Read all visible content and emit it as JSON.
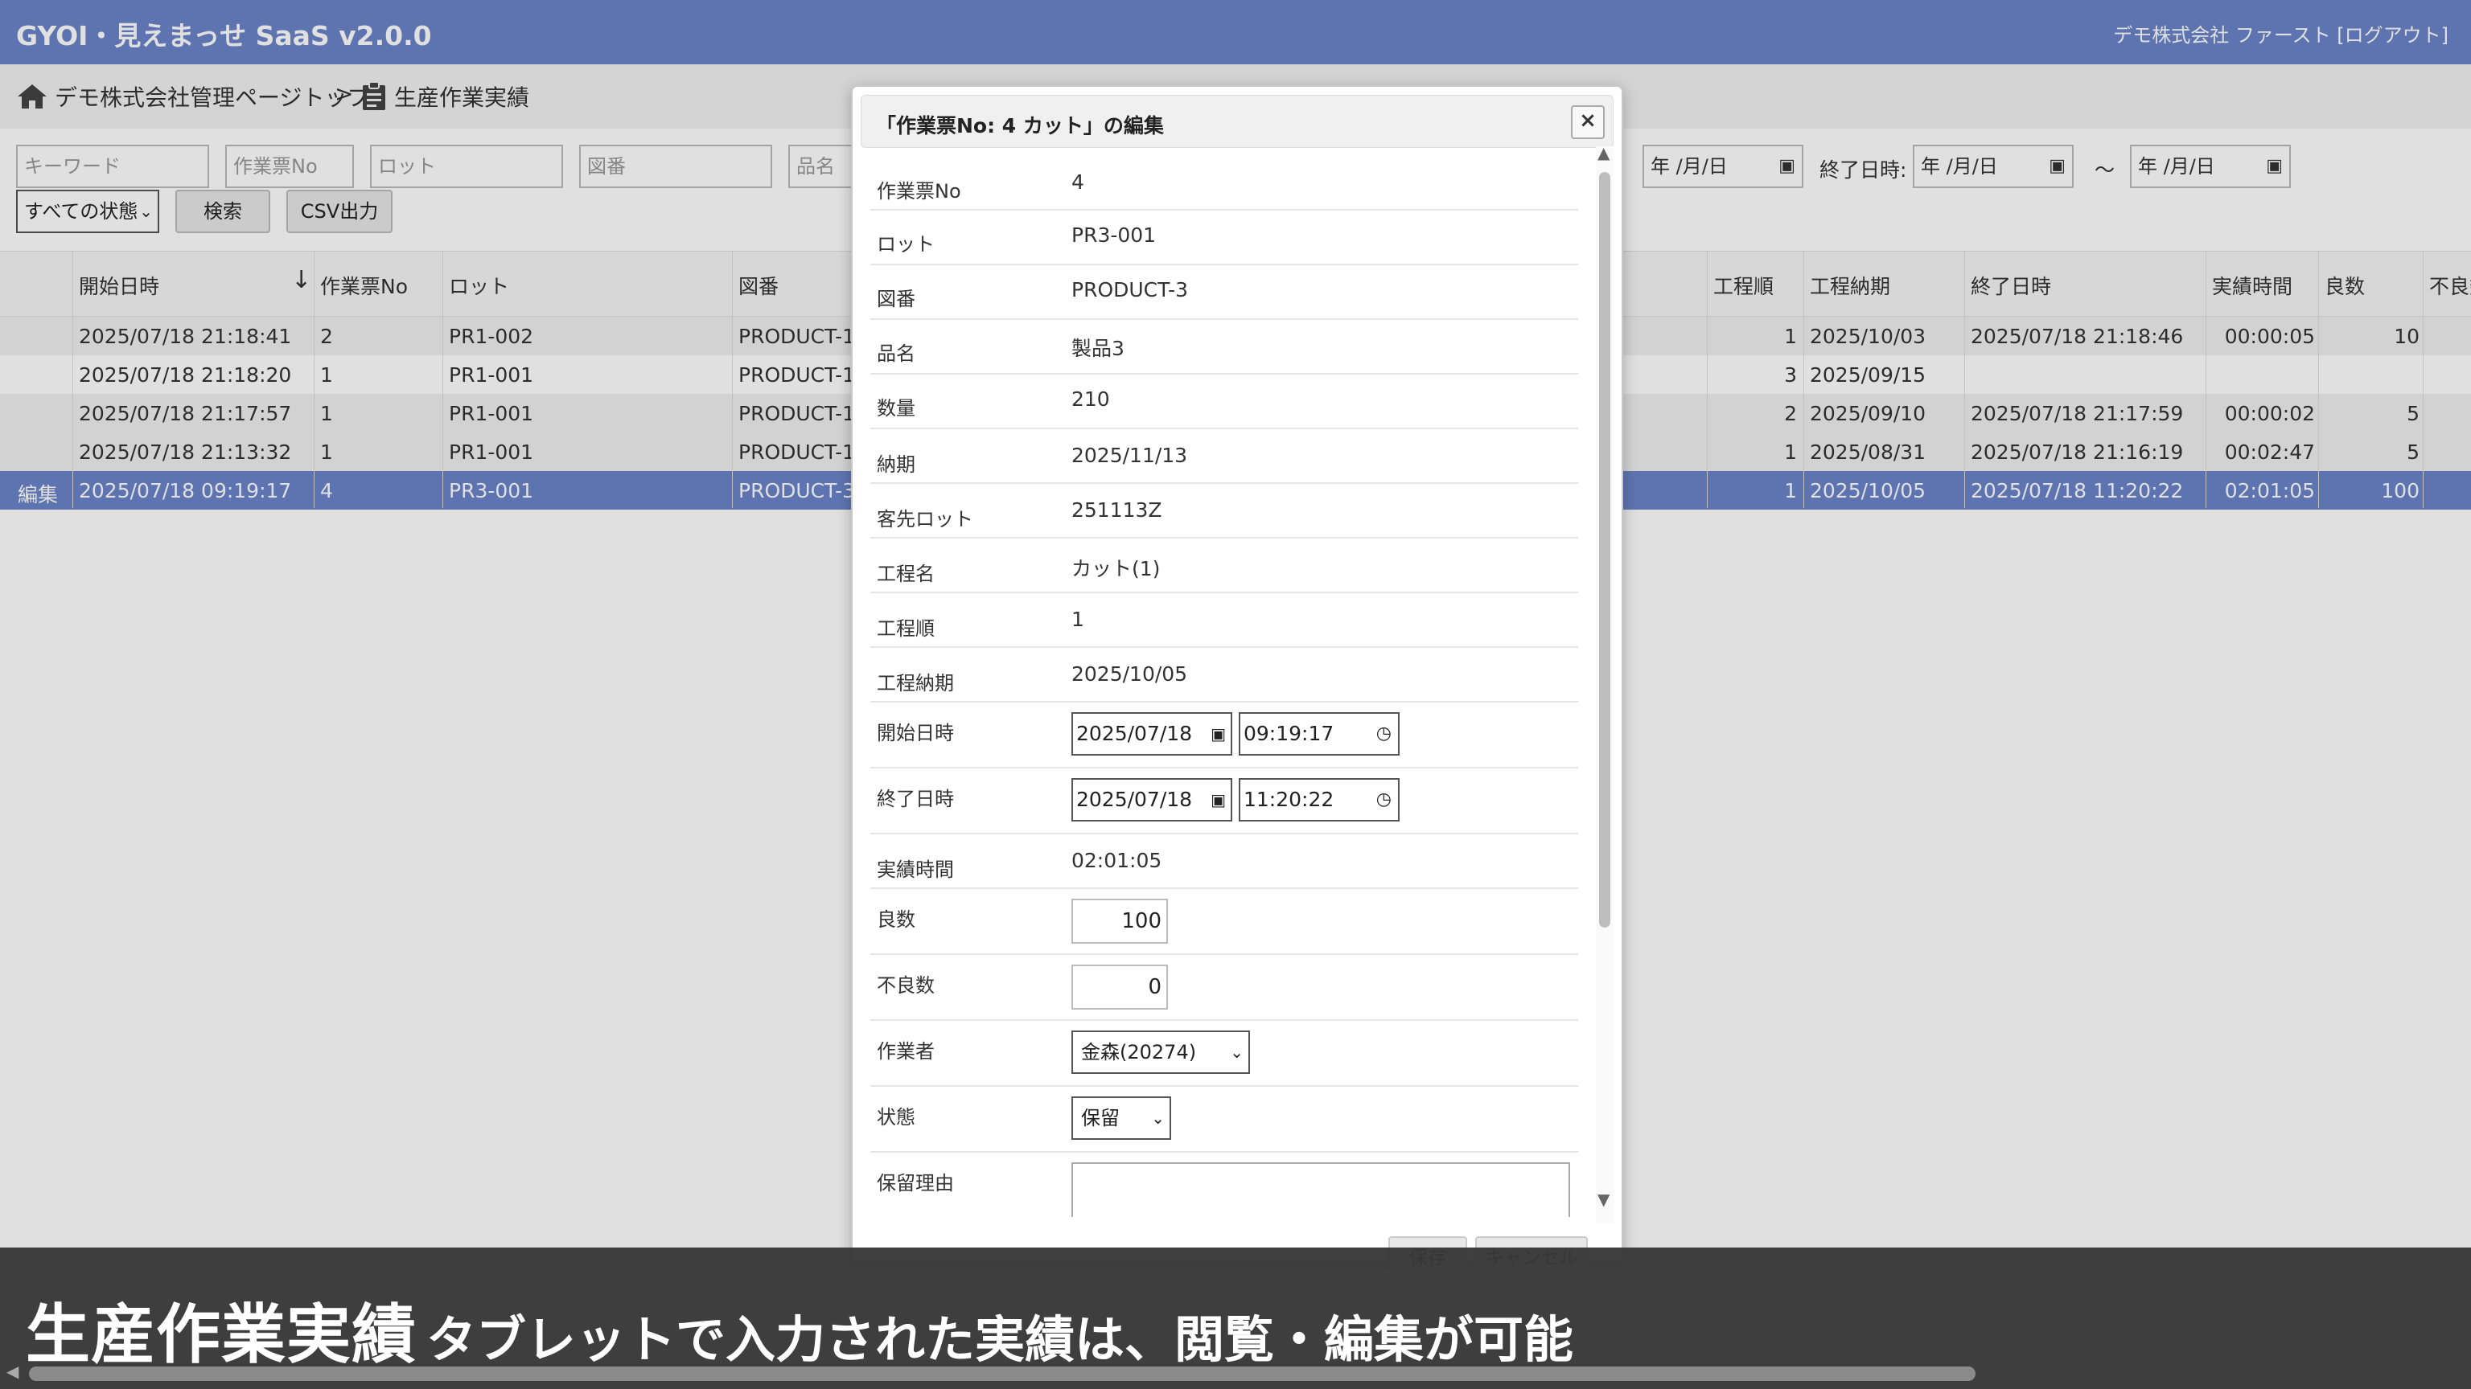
{
  "app": {
    "title": "GYOI・見えまっせ SaaS v2.0.0",
    "user_info": "デモ株式会社 ファースト [ログアウト]"
  },
  "breadcrumb": {
    "home": "デモ株式会社管理ページトップ",
    "separator": ">",
    "current": "生産作業実績"
  },
  "filters": {
    "keyword_placeholder": "キーワード",
    "slip_no_placeholder": "作業票No",
    "lot_placeholder": "ロット",
    "drawing_placeholder": "図番",
    "item_placeholder": "品名",
    "date_placeholder": "年 /月/日",
    "end_date_label": "終了日時:",
    "tilde": "～",
    "status_selected": "すべての状態",
    "search_button": "検索",
    "csv_button": "CSV出力"
  },
  "table": {
    "columns": {
      "start": "開始日時",
      "slip_no": "作業票No",
      "lot": "ロット",
      "drawing": "図番",
      "proc_order": "工程順",
      "proc_due": "工程納期",
      "end": "終了日時",
      "actual": "実績時間",
      "good": "良数",
      "defect": "不良数"
    },
    "rows": [
      {
        "edit": "",
        "start": "2025/07/18 21:18:41",
        "slip_no": "2",
        "lot": "PR1-002",
        "drawing": "PRODUCT-1",
        "proc_order": "1",
        "proc_due": "2025/10/03",
        "end": "2025/07/18 21:18:46",
        "actual": "00:00:05",
        "good": "10"
      },
      {
        "edit": "",
        "start": "2025/07/18 21:18:20",
        "slip_no": "1",
        "lot": "PR1-001",
        "drawing": "PRODUCT-1",
        "proc_order": "3",
        "proc_due": "2025/09/15",
        "end": "",
        "actual": "",
        "good": ""
      },
      {
        "edit": "",
        "start": "2025/07/18 21:17:57",
        "slip_no": "1",
        "lot": "PR1-001",
        "drawing": "PRODUCT-1",
        "proc_order": "2",
        "proc_due": "2025/09/10",
        "end": "2025/07/18 21:17:59",
        "actual": "00:00:02",
        "good": "5"
      },
      {
        "edit": "",
        "start": "2025/07/18 21:13:32",
        "slip_no": "1",
        "lot": "PR1-001",
        "drawing": "PRODUCT-1",
        "proc_order": "1",
        "proc_due": "2025/08/31",
        "end": "2025/07/18 21:16:19",
        "actual": "00:02:47",
        "good": "5"
      },
      {
        "edit": "編集",
        "start": "2025/07/18 09:19:17",
        "slip_no": "4",
        "lot": "PR3-001",
        "drawing": "PRODUCT-3",
        "proc_order": "1",
        "proc_due": "2025/10/05",
        "end": "2025/07/18 11:20:22",
        "actual": "02:01:05",
        "good": "100"
      }
    ]
  },
  "modal": {
    "title": "「作業票No: 4 カット」の編集",
    "fields": {
      "slip_no": {
        "label": "作業票No",
        "value": "4"
      },
      "lot": {
        "label": "ロット",
        "value": "PR3-001"
      },
      "drawing": {
        "label": "図番",
        "value": "PRODUCT-3"
      },
      "item": {
        "label": "品名",
        "value": "製品3"
      },
      "qty": {
        "label": "数量",
        "value": "210"
      },
      "due": {
        "label": "納期",
        "value": "2025/11/13"
      },
      "cust_lot": {
        "label": "客先ロット",
        "value": "251113Z"
      },
      "proc_name": {
        "label": "工程名",
        "value": "カット(1)"
      },
      "proc_order": {
        "label": "工程順",
        "value": "1"
      },
      "proc_due": {
        "label": "工程納期",
        "value": "2025/10/05"
      },
      "start": {
        "label": "開始日時",
        "date": "2025/07/18",
        "time": "09:19:17"
      },
      "end": {
        "label": "終了日時",
        "date": "2025/07/18",
        "time": "11:20:22"
      },
      "actual": {
        "label": "実績時間",
        "value": "02:01:05"
      },
      "good": {
        "label": "良数",
        "value": "100"
      },
      "defect": {
        "label": "不良数",
        "value": "0"
      },
      "worker": {
        "label": "作業者",
        "value": "金森(20274)"
      },
      "status": {
        "label": "状態",
        "value": "保留"
      },
      "hold_reason": {
        "label": "保留理由",
        "value": ""
      }
    },
    "save_button": "保存",
    "cancel_button": "キャンセル"
  },
  "caption": {
    "main": "生産作業実績",
    "sub": "タブレットで入力された実績は、閲覧・編集が可能"
  },
  "colors": {
    "header_bg": "#6a84c9",
    "selected_row_bg": "#6a84c9"
  }
}
